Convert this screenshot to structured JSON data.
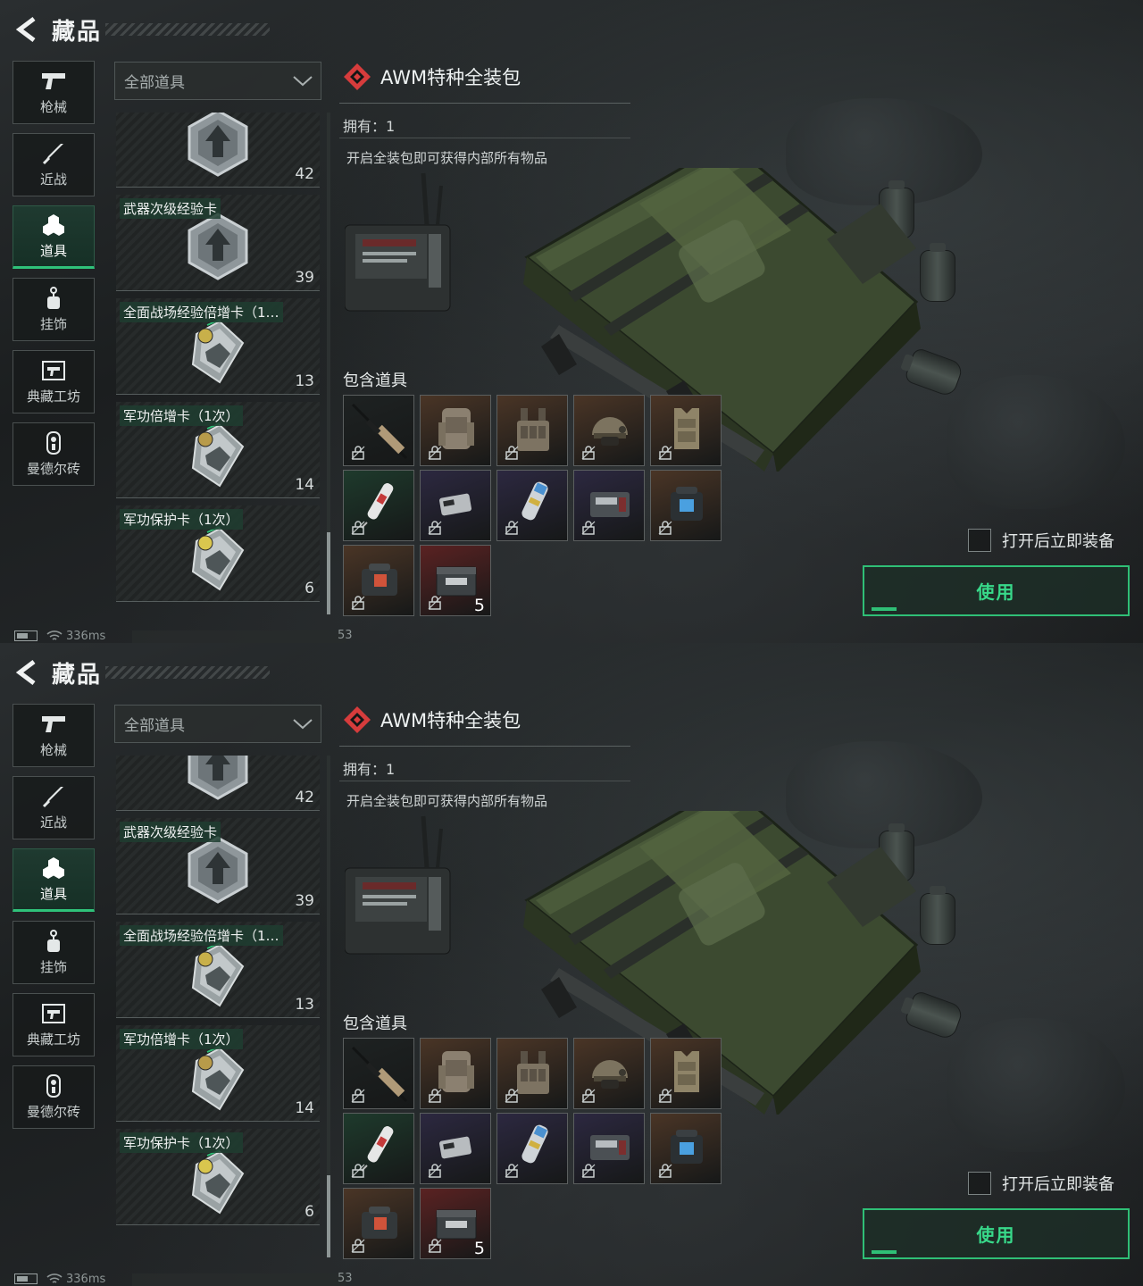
{
  "header": {
    "title": "藏品"
  },
  "sidebar": {
    "items": [
      {
        "label": "枪械",
        "icon": "pistol-icon",
        "active": false
      },
      {
        "label": "近战",
        "icon": "knife-icon",
        "active": false
      },
      {
        "label": "道具",
        "icon": "items-icon",
        "active": true
      },
      {
        "label": "挂饰",
        "icon": "charm-icon",
        "active": false
      },
      {
        "label": "典藏工坊",
        "icon": "workshop-icon",
        "active": false
      },
      {
        "label": "曼德尔砖",
        "icon": "mandel-brick-icon",
        "active": false
      }
    ]
  },
  "filter": {
    "label": "全部道具"
  },
  "item_list": [
    {
      "name": "",
      "qty": "42",
      "icon": "exp-card-icon"
    },
    {
      "name": "武器次级经验卡",
      "qty": "39",
      "icon": "exp-card-icon"
    },
    {
      "name": "全面战场经验倍增卡（1…",
      "qty": "13",
      "icon": "boost-card-icon"
    },
    {
      "name": "军功倍增卡（1次）",
      "qty": "14",
      "icon": "merit-card-icon"
    },
    {
      "name": "军功保护卡（1次）",
      "qty": "6",
      "icon": "shield-card-icon"
    }
  ],
  "detail": {
    "title": "AWM特种全装包",
    "owned": "拥有：1",
    "description": "开启全装包即可获得内部所有物品",
    "contents_title": "包含道具",
    "contents": [
      {
        "icon": "sniper-rifle-icon",
        "rarity_color": "#1e2222",
        "qty": ""
      },
      {
        "icon": "backpack-icon",
        "rarity_color": "#4a3526",
        "qty": ""
      },
      {
        "icon": "chest-rig-icon",
        "rarity_color": "#4a3526",
        "qty": ""
      },
      {
        "icon": "helmet-icon",
        "rarity_color": "#4a3526",
        "qty": ""
      },
      {
        "icon": "body-armor-icon",
        "rarity_color": "#4a3526",
        "qty": ""
      },
      {
        "icon": "syringe-icon",
        "rarity_color": "#1e3a2c",
        "qty": ""
      },
      {
        "icon": "keycard-icon",
        "rarity_color": "#2c2840",
        "qty": ""
      },
      {
        "icon": "injector-icon",
        "rarity_color": "#2c2840",
        "qty": ""
      },
      {
        "icon": "device-icon",
        "rarity_color": "#2c2840",
        "qty": ""
      },
      {
        "icon": "pouch-icon",
        "rarity_color": "#4a3526",
        "qty": ""
      },
      {
        "icon": "medkit-bag-icon",
        "rarity_color": "#4a3526",
        "qty": ""
      },
      {
        "icon": "ammo-box-icon",
        "rarity_color": "#5a2222",
        "qty": "5"
      }
    ],
    "auto_equip_label": "打开后立即装备",
    "use_label": "使用"
  },
  "status": {
    "ping": "336ms",
    "fps": "53"
  },
  "colors": {
    "accent": "#2fbf76",
    "rarity_red": "#d63c3c"
  }
}
